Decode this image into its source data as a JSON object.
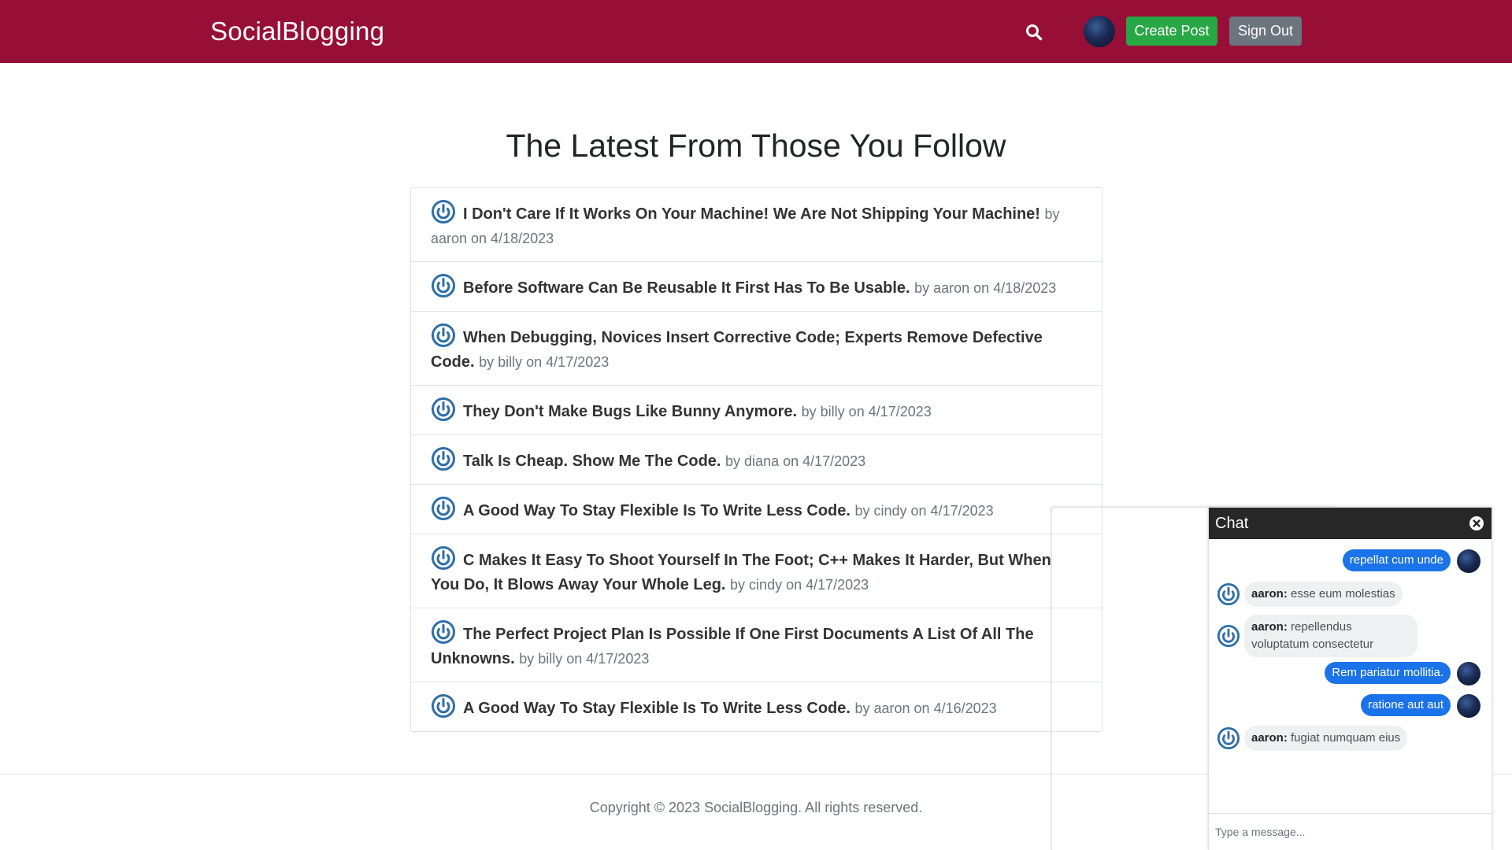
{
  "header": {
    "brand": "SocialBlogging",
    "search_icon": "search-icon",
    "chat_icon": "chat-bubble-icon",
    "create_post_label": "Create Post",
    "sign_out_label": "Sign Out",
    "colors": {
      "bar": "#970f36",
      "create": "#28a745",
      "signout": "#6c757d"
    }
  },
  "main": {
    "title": "The Latest From Those You Follow",
    "posts": [
      {
        "title": "I Don't Care If It Works On Your Machine! We Are Not Shipping Your Machine!",
        "meta": "by aaron on 4/18/2023"
      },
      {
        "title": "Before Software Can Be Reusable It First Has To Be Usable.",
        "meta": "by aaron on 4/18/2023"
      },
      {
        "title": "When Debugging, Novices Insert Corrective Code; Experts Remove Defective Code.",
        "meta": "by billy on 4/17/2023"
      },
      {
        "title": "They Don't Make Bugs Like Bunny Anymore.",
        "meta": "by billy on 4/17/2023"
      },
      {
        "title": "Talk Is Cheap. Show Me The Code.",
        "meta": "by diana on 4/17/2023"
      },
      {
        "title": "A Good Way To Stay Flexible Is To Write Less Code.",
        "meta": "by cindy on 4/17/2023"
      },
      {
        "title": "C Makes It Easy To Shoot Yourself In The Foot; C++ Makes It Harder, But When You Do, It Blows Away Your Whole Leg.",
        "meta": "by cindy on 4/17/2023"
      },
      {
        "title": "The Perfect Project Plan Is Possible If One First Documents A List Of All The Unknowns.",
        "meta": "by billy on 4/17/2023"
      },
      {
        "title": "A Good Way To Stay Flexible Is To Write Less Code.",
        "meta": "by aaron on 4/16/2023"
      }
    ]
  },
  "footer": {
    "text": "Copyright © 2023 SocialBlogging. All rights reserved."
  },
  "chat": {
    "title": "Chat",
    "close_icon": "close-circle-icon",
    "messages": [
      {
        "from": "self",
        "text": "repellat cum unde"
      },
      {
        "from": "other",
        "user": "aaron:",
        "text": "esse eum molestias"
      },
      {
        "from": "other",
        "user": "aaron:",
        "text": "repellendus voluptatum consectetur"
      },
      {
        "from": "self",
        "text": "Rem pariatur mollitia."
      },
      {
        "from": "self",
        "text": "ratione aut aut"
      },
      {
        "from": "other",
        "user": "aaron:",
        "text": "fugiat numquam eius"
      }
    ],
    "input_placeholder": "Type a message..."
  }
}
